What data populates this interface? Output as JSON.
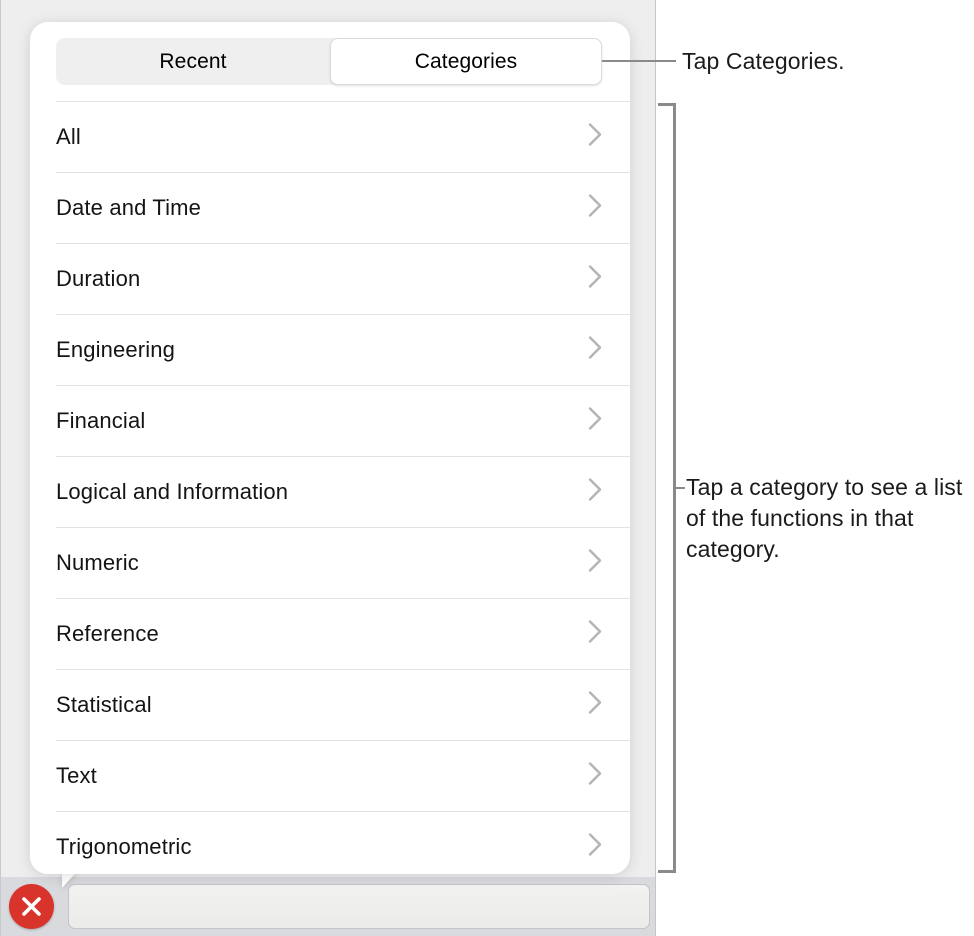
{
  "segmented_control": {
    "segments": [
      {
        "label": "Recent",
        "selected": false
      },
      {
        "label": "Categories",
        "selected": true
      }
    ]
  },
  "category_list": {
    "items": [
      {
        "label": "All"
      },
      {
        "label": "Date and Time"
      },
      {
        "label": "Duration"
      },
      {
        "label": "Engineering"
      },
      {
        "label": "Financial"
      },
      {
        "label": "Logical and Information"
      },
      {
        "label": "Numeric"
      },
      {
        "label": "Reference"
      },
      {
        "label": "Statistical"
      },
      {
        "label": "Text"
      },
      {
        "label": "Trigonometric"
      }
    ],
    "disclosure_icon": "chevron-right-icon"
  },
  "bottom_bar": {
    "close_button_icon": "close-x-icon",
    "formula_field_value": "",
    "formula_field_placeholder": ""
  },
  "callouts": [
    {
      "id": "callout-tap-categories",
      "text": "Tap Categories."
    },
    {
      "id": "callout-tap-a-category",
      "text": "Tap a category to see a list of the functions in that category."
    }
  ],
  "colors": {
    "close_button": "#d8342c",
    "segmented_track": "#efeff0",
    "selected_segment": "#ffffff",
    "separator": "#e2e2e2",
    "callout_line": "#8a8a8a",
    "app_backdrop": "#eeeeee",
    "bottom_bar": "#d9dade"
  }
}
